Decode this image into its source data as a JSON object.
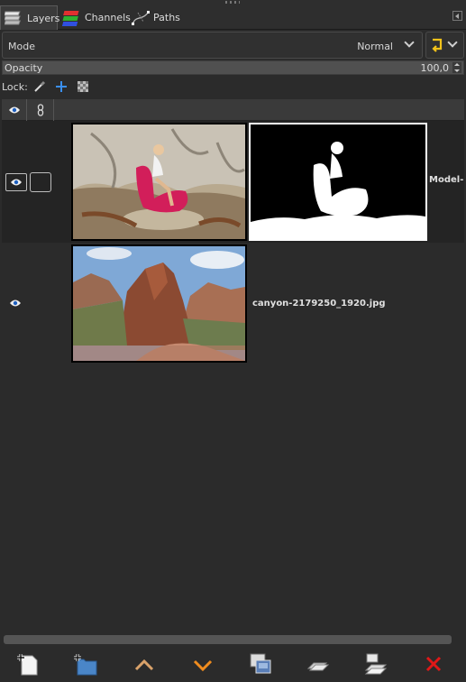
{
  "tabs": [
    {
      "label": "Layers",
      "icon": "layers-icon",
      "active": true
    },
    {
      "label": "Channels",
      "icon": "channels-icon",
      "active": false
    },
    {
      "label": "Paths",
      "icon": "paths-icon",
      "active": false
    }
  ],
  "mode": {
    "label": "Mode",
    "value": "Normal"
  },
  "opacity": {
    "label": "Opacity",
    "value": "100,0"
  },
  "lock": {
    "label": "Lock:",
    "items": [
      "lock-pixels-icon",
      "lock-position-icon",
      "lock-alpha-icon"
    ]
  },
  "layers": [
    {
      "name": "Model-",
      "visible": true,
      "selected": true,
      "has_mask": true
    },
    {
      "name": "canyon-2179250_1920.jpg",
      "visible": true,
      "selected": false,
      "has_mask": false
    }
  ],
  "toolbar": [
    "new-layer-icon",
    "new-layer-group-icon",
    "raise-layer-icon",
    "lower-layer-icon",
    "duplicate-layer-icon",
    "anchor-layer-icon",
    "merge-down-icon",
    "delete-layer-icon"
  ],
  "colors": {
    "background": "#2b2b2b",
    "selected_row": "#242424",
    "accent_orange": "#f08c1e",
    "delete_red": "#e01818"
  }
}
